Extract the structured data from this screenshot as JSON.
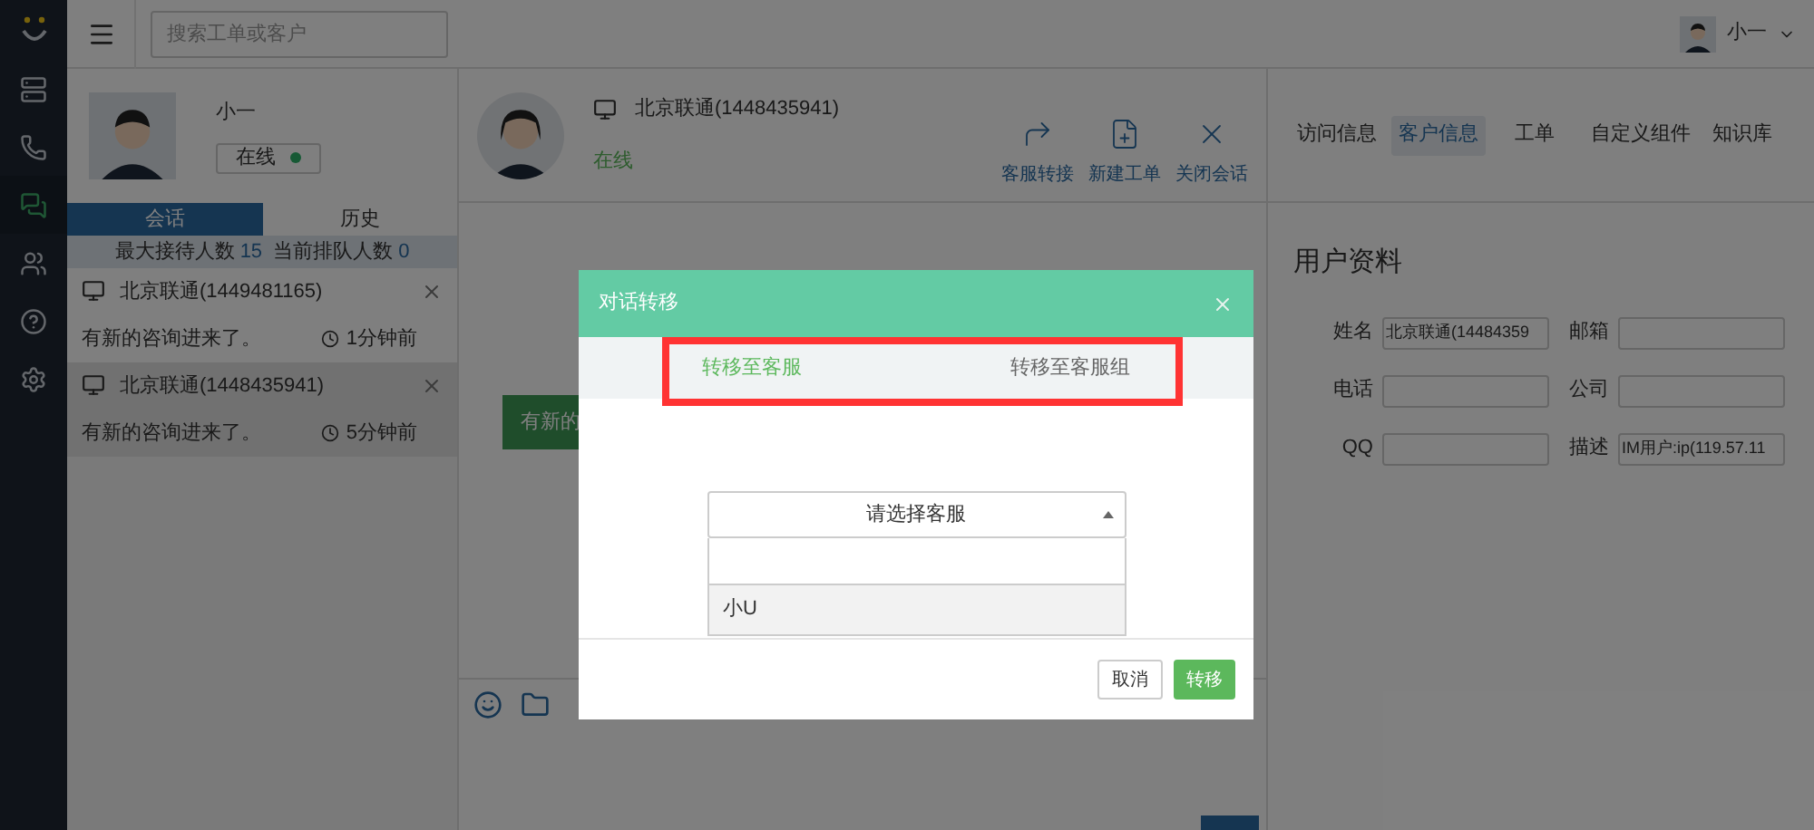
{
  "nav": [
    {
      "kind": "server",
      "selected": false
    },
    {
      "kind": "phone",
      "selected": false
    },
    {
      "kind": "chat",
      "selected": true
    },
    {
      "kind": "users",
      "selected": false
    },
    {
      "kind": "help",
      "selected": false
    },
    {
      "kind": "settings",
      "selected": false
    }
  ],
  "topbar": {
    "search_placeholder": "搜索工单或客户",
    "user": "小一"
  },
  "agent": {
    "name": "小一",
    "status": "在线",
    "online": true
  },
  "session_tabs": [
    {
      "label": "会话",
      "selected": true
    },
    {
      "label": "历史",
      "selected": false
    }
  ],
  "stats": [
    {
      "label": "最大接待人数",
      "value": "15"
    },
    {
      "label": "当前排队人数",
      "value": "0"
    }
  ],
  "sessions": [
    {
      "name": "北京联通(1449481165)",
      "message": "有新的咨询进来了。",
      "time": "1分钟前",
      "selected": false
    },
    {
      "name": "北京联通(1448435941)",
      "message": "有新的咨询进来了。",
      "time": "5分钟前",
      "selected": true
    }
  ],
  "chat": {
    "customer": "北京联通(1448435941)",
    "status": "在线",
    "bubble": "有新的",
    "actions": [
      {
        "kind": "transfer",
        "label": "客服转接"
      },
      {
        "kind": "new",
        "label": "新建工单"
      },
      {
        "kind": "close",
        "label": "关闭会话"
      }
    ]
  },
  "right_tabs": [
    {
      "label": "访问信息",
      "selected": false
    },
    {
      "label": "客户信息",
      "selected": true
    },
    {
      "label": "工单",
      "selected": false
    },
    {
      "label": "自定义组件",
      "selected": false
    },
    {
      "label": "知识库",
      "selected": false
    }
  ],
  "profile": {
    "title": "用户资料",
    "fields": [
      {
        "label": "姓名",
        "value": "北京联通(14484359"
      },
      {
        "label": "邮箱"
      },
      {
        "label": "电话"
      },
      {
        "label": "公司"
      },
      {
        "label": "QQ"
      },
      {
        "label": "描述",
        "value": "IM用户:ip(119.57.11"
      }
    ]
  },
  "dialog": {
    "title": "对话转移",
    "highlighted": true,
    "tabs": [
      {
        "label": "转移至客服",
        "selected": true
      },
      {
        "label": "转移至客服组",
        "selected": false
      }
    ],
    "select": {
      "placeholder": "请选择客服",
      "expanded": true,
      "options": [
        {
          "label": "小U",
          "selected": true
        }
      ]
    },
    "buttons": [
      {
        "kind": "cancel",
        "label": "取消"
      },
      {
        "kind": "primary",
        "label": "转移"
      }
    ]
  }
}
